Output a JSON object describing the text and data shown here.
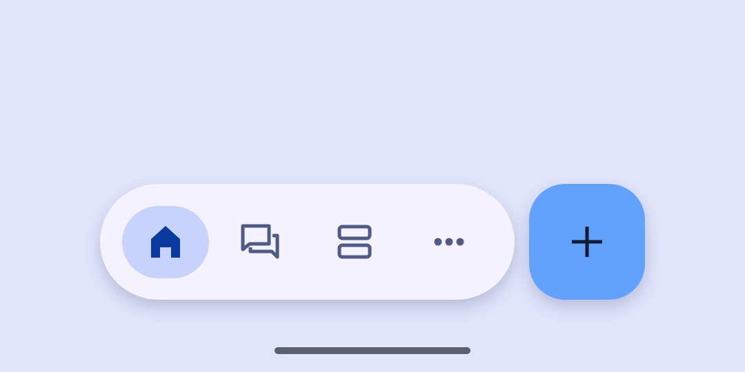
{
  "nav_bar": {
    "items": [
      {
        "kind": "home",
        "selected": true
      },
      {
        "kind": "chat",
        "selected": false
      },
      {
        "kind": "list",
        "selected": false
      },
      {
        "kind": "more",
        "selected": false
      }
    ]
  },
  "fab": {
    "kind": "add"
  }
}
